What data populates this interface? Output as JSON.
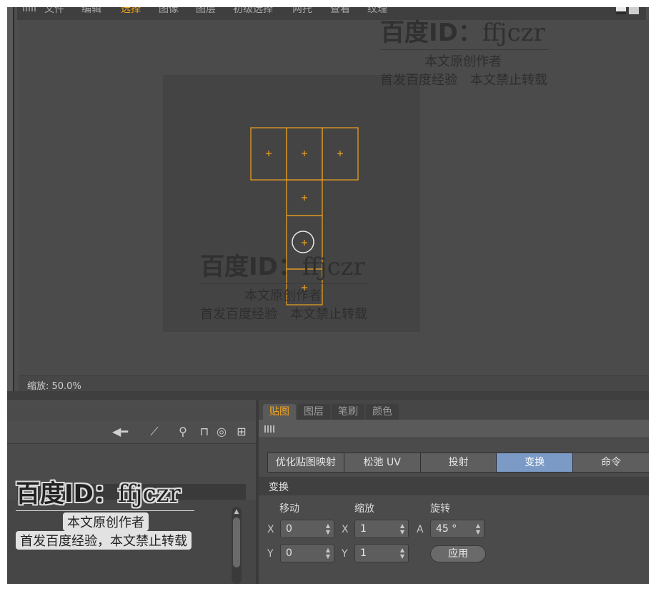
{
  "menu": {
    "items": [
      "文件",
      "编辑",
      "选择",
      "图像",
      "图层",
      "初级选择",
      "两托",
      "查看",
      "纹理"
    ],
    "active_index": 2
  },
  "viewport": {
    "zoom_text": "缩放: 50.0%"
  },
  "panel_tabs": [
    "贴图",
    "图层",
    "笔刷",
    "颜色"
  ],
  "panel_active_tab": 0,
  "mode_buttons": [
    "优化贴图映射",
    "松弛 UV",
    "投射",
    "变换",
    "命令"
  ],
  "mode_selected": 3,
  "transform": {
    "section_title": "变换",
    "move_label": "移动",
    "scale_label": "缩放",
    "rotate_label": "旋转",
    "move_x": "0",
    "move_y": "0",
    "scale_x": "1",
    "scale_y": "1",
    "angle": "45 °",
    "axis_x": "X",
    "axis_y": "Y",
    "axis_a": "A",
    "apply_label": "应用"
  },
  "watermark": {
    "id_prefix": "百度ID：",
    "id_name": "ffjczr",
    "line1": "本文原创作者",
    "line2": "首发百度经验　本文禁止转载",
    "line2_alt": "首发百度经验，本文禁止转载"
  },
  "colors": {
    "accent": "#f0a31e",
    "uv_edge": "#f0a31e",
    "selected_button": "#7b9bc6"
  }
}
